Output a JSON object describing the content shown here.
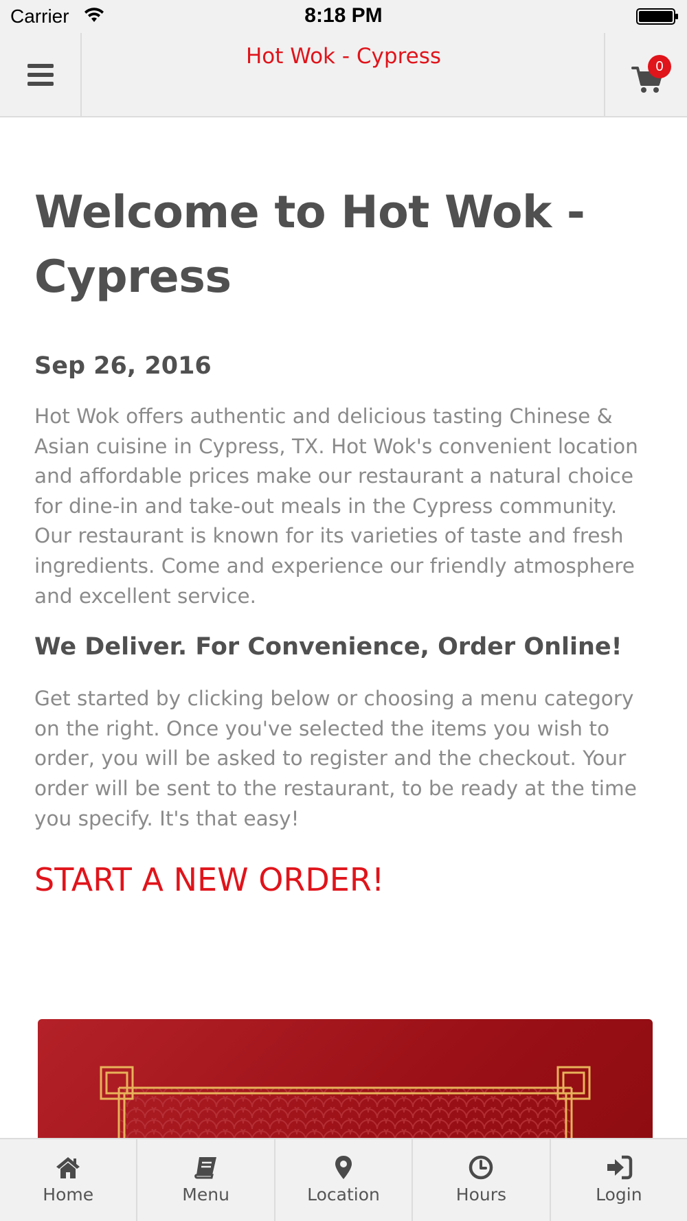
{
  "status_bar": {
    "carrier": "Carrier",
    "time": "8:18 PM"
  },
  "header": {
    "title": "Hot Wok - Cypress",
    "cart_count": "0",
    "accent_color": "#e0141b"
  },
  "content": {
    "welcome_title": "Welcome to Hot Wok - Cypress",
    "date": "Sep 26, 2016",
    "intro": "Hot Wok offers authentic and delicious tasting Chinese & Asian cuisine in Cypress, TX. Hot Wok's convenient location and affordable prices make our restaurant a natural choice for dine-in and take-out meals in the Cypress community. Our restaurant is known for its varieties of taste and fresh ingredients. Come and experience our friendly atmosphere and excellent service.",
    "deliver_heading": "We Deliver. For Convenience, Order Online!",
    "instructions": "Get started by clicking below or choosing a menu category on the right. Once you've selected the items you wish to order, you will be asked to register and the checkout. Your order will be sent to the restaurant, to be ready at the time you specify. It's that easy!",
    "start_order": "START A NEW ORDER!"
  },
  "tab_bar": {
    "items": [
      {
        "label": "Home",
        "icon": "home-icon"
      },
      {
        "label": "Menu",
        "icon": "book-icon"
      },
      {
        "label": "Location",
        "icon": "map-pin-icon"
      },
      {
        "label": "Hours",
        "icon": "clock-icon"
      },
      {
        "label": "Login",
        "icon": "sign-in-icon"
      }
    ]
  }
}
